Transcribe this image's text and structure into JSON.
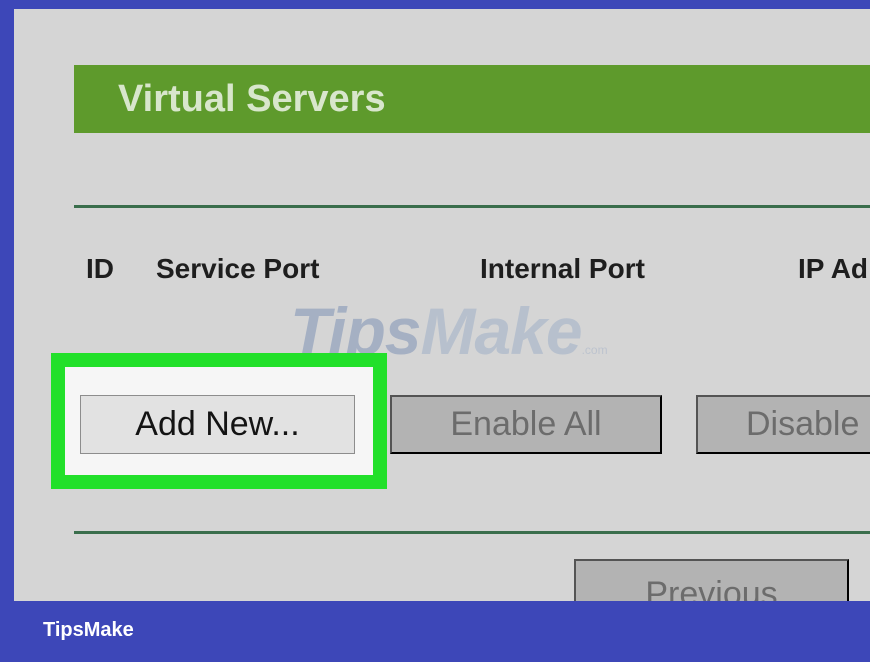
{
  "panel": {
    "title": "Virtual Servers",
    "table_headers": [
      "ID",
      "Service Port",
      "Internal Port",
      "IP Ad"
    ],
    "buttons": {
      "add_new": "Add New...",
      "enable_all": "Enable All",
      "disable_all": "Disable",
      "previous": "Previous"
    }
  },
  "watermark": {
    "part1": "Tips",
    "part2": "Make",
    "suffix": ".com"
  },
  "footer": {
    "brand": "TipsMake"
  },
  "colors": {
    "title_bar": "#5e9a2c",
    "highlight": "#22e02a",
    "frame": "#3d47b8",
    "panel": "#d5d5d5"
  }
}
